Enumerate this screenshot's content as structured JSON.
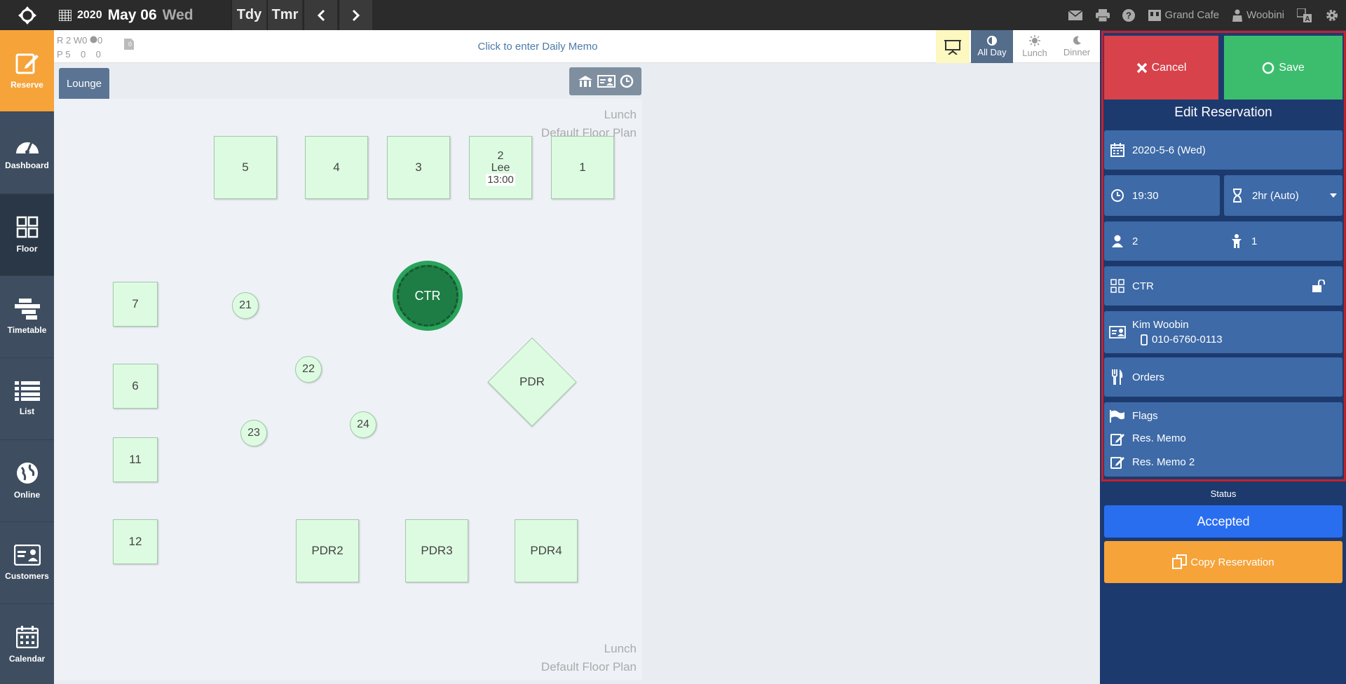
{
  "topbar": {
    "year": "2020",
    "month_day": "May 06",
    "weekday": "Wed",
    "today_label": "Tdy",
    "tomorrow_label": "Tmr",
    "restaurant": "Grand Cafe",
    "user": "Woobini"
  },
  "leftnav": {
    "items": [
      {
        "label": "Reserve",
        "icon": "reserve-icon"
      },
      {
        "label": "Dashboard",
        "icon": "dashboard-icon"
      },
      {
        "label": "Floor",
        "icon": "floor-icon"
      },
      {
        "label": "Timetable",
        "icon": "timetable-icon"
      },
      {
        "label": "List",
        "icon": "list-icon"
      },
      {
        "label": "Online",
        "icon": "globe-icon"
      },
      {
        "label": "Customers",
        "icon": "customers-icon"
      },
      {
        "label": "Calendar",
        "icon": "calendar-icon"
      }
    ]
  },
  "memobar": {
    "r_label": "R",
    "r_res": "2",
    "w_label": "W",
    "w_res": "0",
    "o_res": "0",
    "p_label": "P",
    "p_val1": "5",
    "p_val2": "0",
    "p_val3": "0",
    "clip_count": "0",
    "memo_placeholder": "Click to enter Daily Memo",
    "shifts": {
      "all_day": "All Day",
      "lunch": "Lunch",
      "dinner": "Dinner"
    }
  },
  "floor": {
    "area_tab": "Lounge",
    "shift_label": "Lunch",
    "plan_label": "Default Floor Plan",
    "tables": {
      "t5": "5",
      "t4": "4",
      "t3": "3",
      "t2": "2",
      "t2_name": "Lee",
      "t2_time": "13:00",
      "t1": "1",
      "t7": "7",
      "t6": "6",
      "t11": "11",
      "t12": "12",
      "t21": "21",
      "t22": "22",
      "t23": "23",
      "t24": "24",
      "ctr": "CTR",
      "pdr": "PDR",
      "pdr2": "PDR2",
      "pdr3": "PDR3",
      "pdr4": "PDR4"
    }
  },
  "edit": {
    "cancel_label": "Cancel",
    "save_label": "Save",
    "title": "Edit Reservation",
    "date": "2020-5-6 (Wed)",
    "time": "19:30",
    "duration": "2hr (Auto)",
    "adults": "2",
    "kids": "1",
    "table": "CTR",
    "customer_name": "Kim Woobin",
    "customer_phone": "010-6760-0113",
    "orders_label": "Orders",
    "flags_label": "Flags",
    "memo_label": "Res. Memo",
    "memo2_label": "Res. Memo 2",
    "status_label": "Status",
    "status_value": "Accepted",
    "copy_label": "Copy Reservation"
  },
  "colors": {
    "accent_orange": "#f6a33a",
    "cancel_red": "#d8424b",
    "save_green": "#3cbd6e",
    "panel_blue": "#1d3a6e",
    "status_blue": "#2a6ef0"
  }
}
